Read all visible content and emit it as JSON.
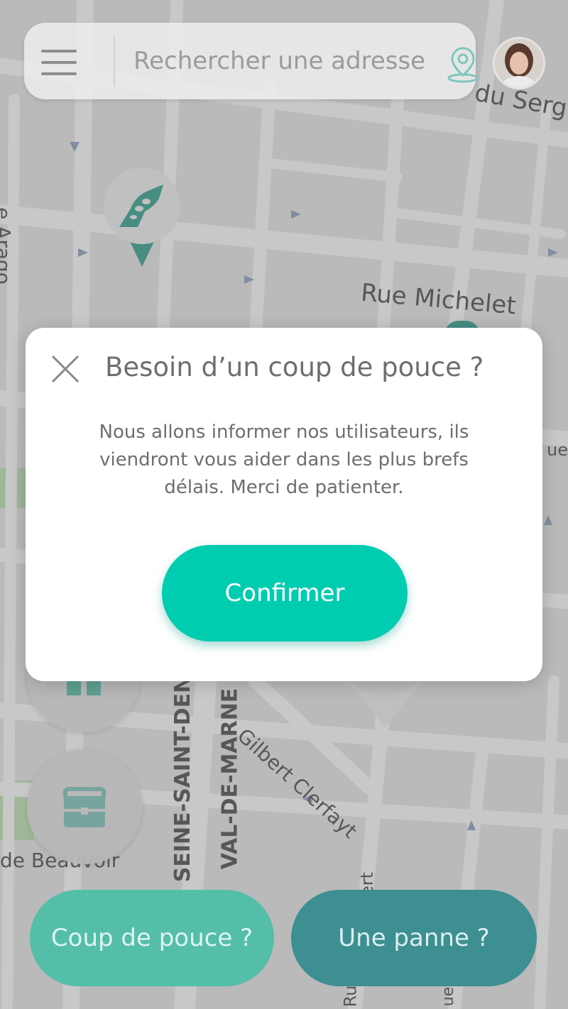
{
  "search": {
    "placeholder": "Rechercher une adresse"
  },
  "map": {
    "streets": {
      "rue_michelet": "Rue Michelet",
      "du_serg": "du Serg",
      "arago": "e Arago",
      "gilbert_clerfayt": "Gilbert Clerfayt",
      "seine_saint_denis": "SEINE-SAINT-DEN",
      "val_de_marne": "VAL-DE-MARNE",
      "de_beauvoir": "de Beauvoir",
      "right_edge": "ue",
      "bottom_rue": "Ru",
      "bottom_ert": "ert",
      "bottom_ue": "ue"
    }
  },
  "modal": {
    "title": "Besoin d’un coup de pouce ?",
    "body": "Nous allons informer nos utilisateurs, ils viendront vous aider dans les plus brefs délais. Merci de patienter.",
    "confirm_label": "Confirmer"
  },
  "bottom": {
    "coup_de_pouce_label": "Coup de pouce ?",
    "panne_label": "Une panne ?"
  },
  "colors": {
    "accent": "#00ccb0",
    "coup_button": "#55bea8",
    "panne_button": "#3d8f92",
    "marker": "#2fa08f"
  },
  "icons": {
    "menu": "hamburger-menu-icon",
    "location": "location-pin-icon",
    "close": "close-icon",
    "marker": "hand-help-marker-icon",
    "briefcase": "briefcase-icon"
  }
}
